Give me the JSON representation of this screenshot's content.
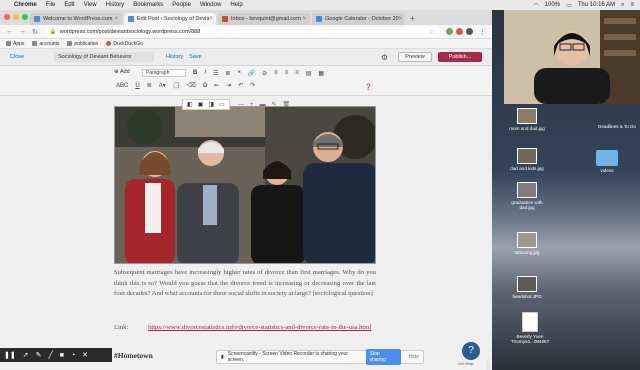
{
  "menubar": {
    "app": "Chrome",
    "items": [
      "File",
      "Edit",
      "View",
      "History",
      "Bookmarks",
      "People",
      "Window",
      "Help"
    ],
    "battery": "100%",
    "clock": "Thu 10:16 AM"
  },
  "tabs": [
    {
      "label": "Welcome to WordPress.com",
      "color": "#4a90d9"
    },
    {
      "label": "Edit Post ‹ Sociology of Devia",
      "color": "#4a90d9"
    },
    {
      "label": "Inbox - bevquint@gmail.com",
      "color": "#d44638"
    },
    {
      "label": "Google Calendar - October 20",
      "color": "#4285f4"
    }
  ],
  "url": "wordpress.com/post/deviantsociology.wordpress.com/888",
  "bookmarks": [
    "Apps",
    "accounts",
    "publication",
    "DuckDuckGo"
  ],
  "wp": {
    "close": "Close",
    "site_title": "Sociology of Deviant Behavior",
    "history": "History",
    "save": "Save",
    "preview": "Preview",
    "publish": "Publish..."
  },
  "toolbar": {
    "add": "Add",
    "paragraph": "Paragraph"
  },
  "content": {
    "paragraph": "Subsequent marriages have increasingly higher rates of divorce than first marriages. Why do you think this is so? Would you guess that the divorce trend is increasing or decreasing over the last four decades? And what accounts for these social shifts in society at large? [sociological question]",
    "link_label": "Link:",
    "link_url": "https://www.divorcestatistics.info/divorce-statistics-and-divorce-rate-in-the-usa.html",
    "heading": "#Hometown"
  },
  "share_bar": {
    "message": "Screencastify - Screen Video Recorder is sharing your screen.",
    "stop": "Stop sharing",
    "hide": "Hide"
  },
  "help": "Get Help",
  "desktop": {
    "items": [
      {
        "label": "mom and dad.jpg",
        "type": "image"
      },
      {
        "label": "Deadlines & To Do",
        "type": "text"
      },
      {
        "label": "dad and kids.jpg",
        "type": "image"
      },
      {
        "label": "videos",
        "type": "folder"
      },
      {
        "label": "graduation with dad.jpg",
        "type": "image"
      },
      {
        "label": "tattooing.jpg",
        "type": "image"
      },
      {
        "label": "headshot.JPG",
        "type": "image"
      },
      {
        "label": "Beverly Yuen Thompsö...084867 ",
        "type": "document"
      }
    ]
  }
}
